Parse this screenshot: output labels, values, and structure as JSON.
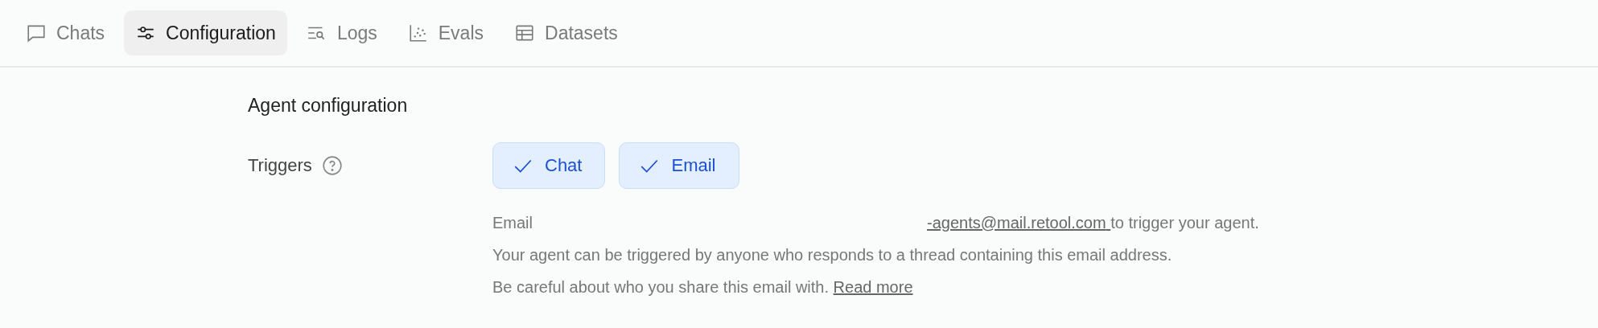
{
  "tabs": [
    {
      "label": "Chats",
      "kind": "chat",
      "selected": false
    },
    {
      "label": "Configuration",
      "kind": "sliders",
      "selected": true
    },
    {
      "label": "Logs",
      "kind": "logs",
      "selected": false
    },
    {
      "label": "Evals",
      "kind": "scatter",
      "selected": false
    },
    {
      "label": "Datasets",
      "kind": "table",
      "selected": false
    }
  ],
  "section": {
    "title": "Agent configuration",
    "triggers": {
      "label": "Triggers",
      "options": [
        {
          "label": "Chat",
          "selected": true
        },
        {
          "label": "Email",
          "selected": true
        }
      ],
      "email_line": {
        "prefix": "Email",
        "link": "-agents@mail.retool.com",
        "suffix": "to trigger your agent."
      },
      "notice": "Your agent can be triggered by anyone who responds to a thread containing this email address.",
      "warning": {
        "text": "Be careful about who you share this email with.",
        "link": "Read more"
      }
    }
  }
}
